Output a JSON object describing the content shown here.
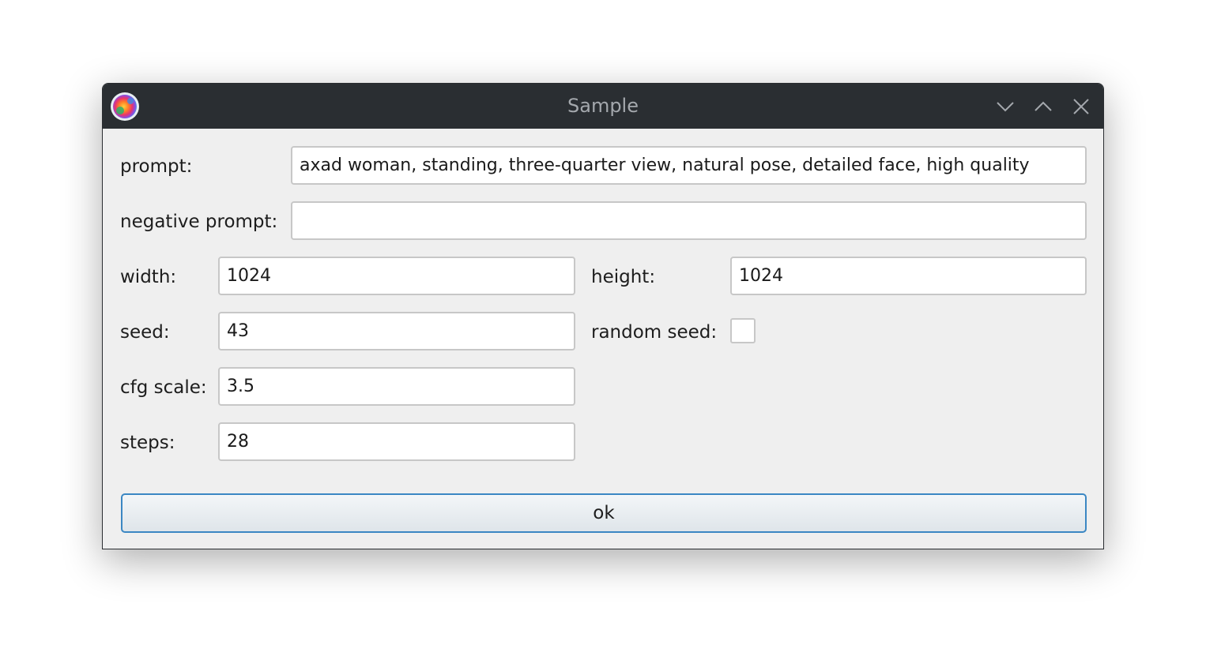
{
  "window": {
    "title": "Sample",
    "icon": "app-logo-icon",
    "controls": [
      "minimize-icon",
      "maximize-icon",
      "close-icon"
    ]
  },
  "form": {
    "prompt": {
      "label": "prompt:",
      "value": "axad woman, standing, three-quarter view, natural pose, detailed face, high quality"
    },
    "negative_prompt": {
      "label": "negative prompt:",
      "value": ""
    },
    "width": {
      "label": "width:",
      "value": "1024"
    },
    "height": {
      "label": "height:",
      "value": "1024"
    },
    "seed": {
      "label": "seed:",
      "value": "43"
    },
    "random_seed": {
      "label": "random seed:",
      "checked": false
    },
    "cfg_scale": {
      "label": "cfg scale:",
      "value": "3.5"
    },
    "steps": {
      "label": "steps:",
      "value": "28"
    },
    "ok_label": "ok"
  },
  "colors": {
    "titlebar": "#2a2e32",
    "window_bg": "#efefef",
    "accent": "#3b87c3"
  }
}
